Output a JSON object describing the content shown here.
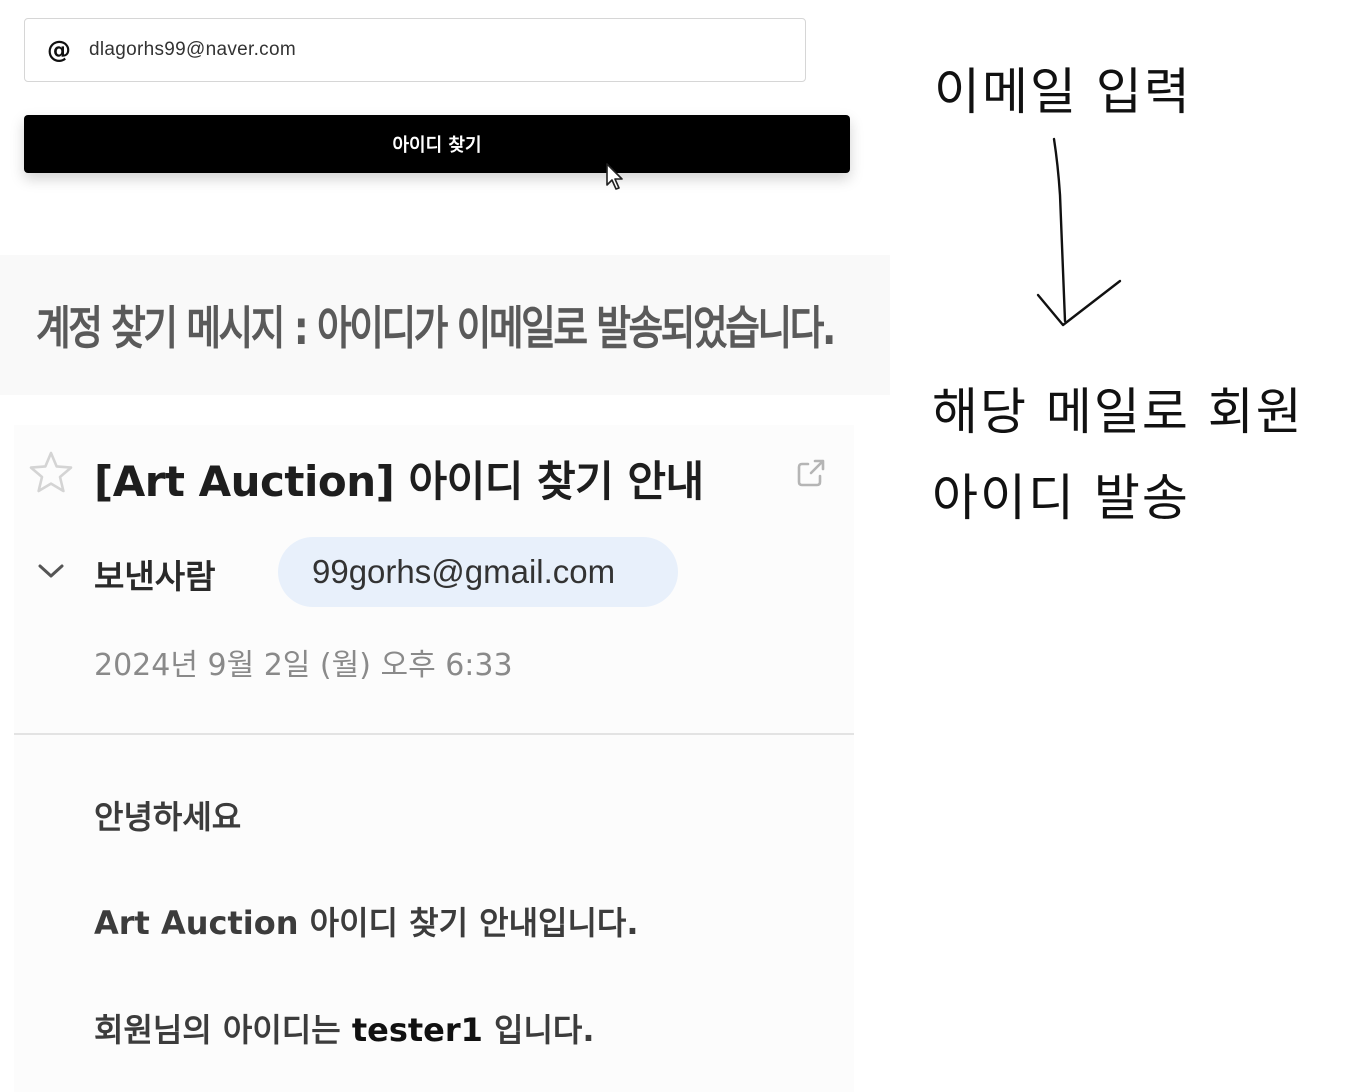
{
  "form": {
    "email_value": "dlagorhs99@naver.com",
    "at_symbol": "@",
    "find_button_label": "아이디 찾기"
  },
  "caption": {
    "text": "계정 찾기 메시지 : 아이디가 이메일로 발송되었습니다."
  },
  "mail": {
    "subject": "[Art Auction] 아이디 찾기 안내",
    "sender_label": "보낸사람",
    "sender_email": "99gorhs@gmail.com",
    "date": "2024년 9월 2일 (월) 오후 6:33",
    "body": {
      "greeting": "안녕하세요",
      "intro": "Art Auction 아이디 찾기 안내입니다.",
      "result_prefix": "회원님의 아이디는 ",
      "user_id": "tester1",
      "result_suffix": " 입니다."
    }
  },
  "annotations": {
    "input_note": "이메일 입력",
    "send_note_line1": "해당 메일로 회원",
    "send_note_line2": "아이디 발송"
  },
  "icons": {
    "at": "at-icon",
    "cursor": "cursor-icon",
    "star": "star-icon",
    "external": "external-link-icon",
    "chevron": "chevron-down-icon",
    "arrow": "arrow-down-icon"
  },
  "colors": {
    "button_bg": "#000000",
    "sender_chip_bg": "#e8f0fb",
    "date_text": "#8a8a8a"
  }
}
